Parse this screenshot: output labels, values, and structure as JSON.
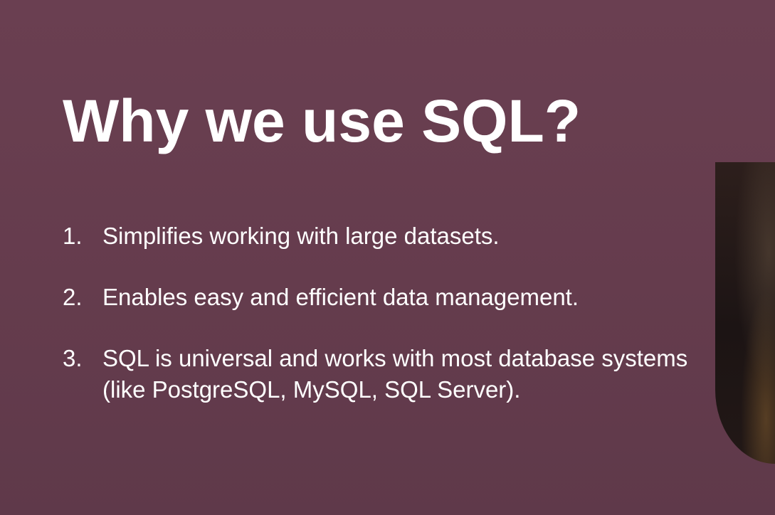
{
  "slide": {
    "title": "Why we use SQL?",
    "points": [
      {
        "number": "1.",
        "text": "Simplifies working with large datasets."
      },
      {
        "number": "2.",
        "text": "Enables easy and efficient data management."
      },
      {
        "number": "3.",
        "text": "SQL is universal and works with most database systems (like PostgreSQL, MySQL, SQL Server)."
      }
    ]
  },
  "colors": {
    "background": "#663d4e",
    "text": "#ffffff"
  }
}
